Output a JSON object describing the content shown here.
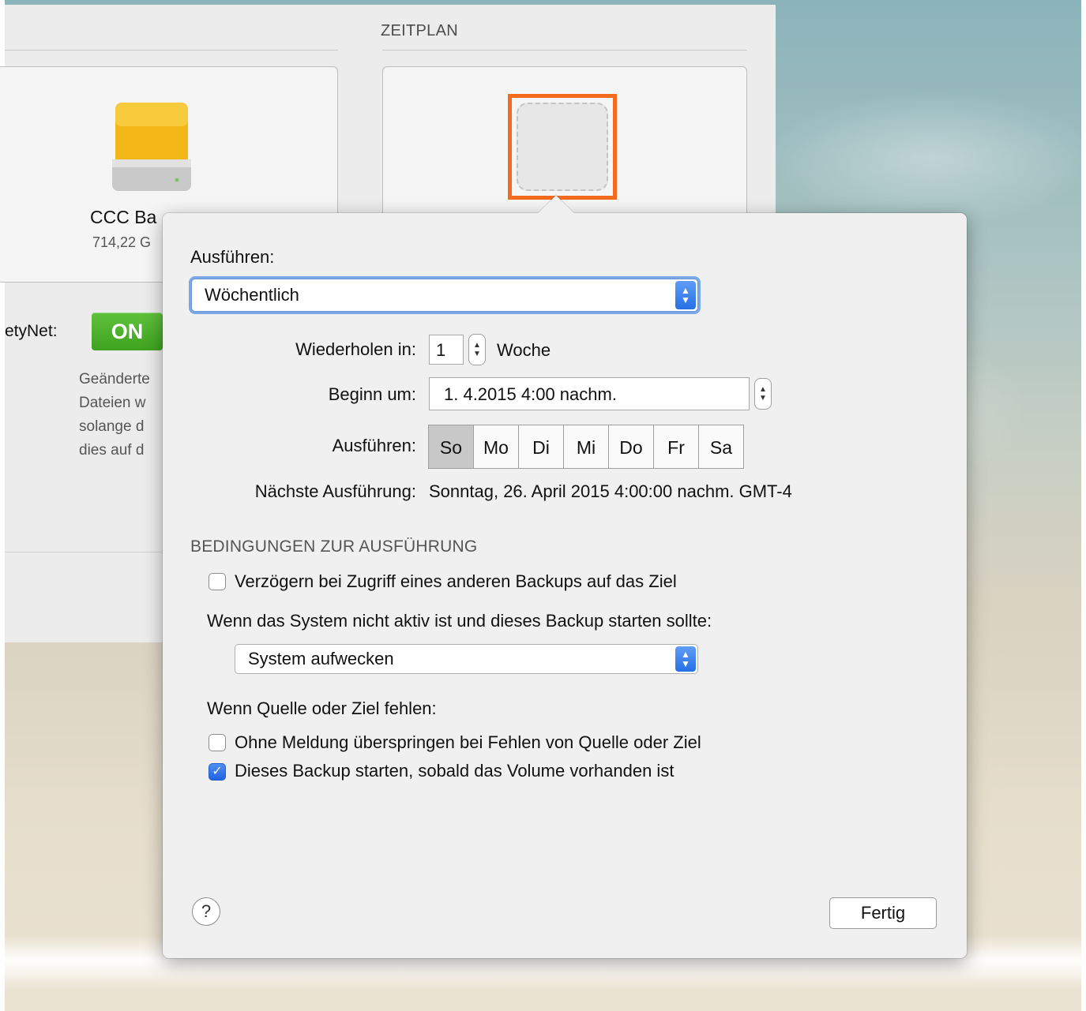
{
  "back_window": {
    "schedule_section_title": "ZEITPLAN",
    "source_drive_title": "CCC Ba",
    "source_drive_size": "714,22 G",
    "safetynet_label": "etyNet:",
    "safetynet_switch": "ON",
    "safetynet_desc": [
      "Geänderte",
      "Dateien w",
      "solange d",
      "dies auf d"
    ]
  },
  "popover": {
    "run_label": "Ausführen:",
    "frequency": "Wöchentlich",
    "repeat_label": "Wiederholen in:",
    "repeat_value": "1",
    "repeat_unit": "Woche",
    "start_label": "Beginn um:",
    "start_value": "1.  4.2015   4:00 nachm.",
    "days_label": "Ausführen:",
    "days": [
      "So",
      "Mo",
      "Di",
      "Mi",
      "Do",
      "Fr",
      "Sa"
    ],
    "selected_day": "So",
    "next_run_label": "Nächste Ausführung:",
    "next_run_value": "Sonntag, 26. April 2015 4:00:00 nachm. GMT-4",
    "conditions_title": "BEDINGUNGEN ZUR AUSFÜHRUNG",
    "delay_checkbox_label": "Verzögern bei Zugriff eines anderen Backups auf das Ziel",
    "delay_checked": false,
    "inactive_label": "Wenn das System nicht aktiv ist und dieses Backup starten sollte:",
    "inactive_option": "System aufwecken",
    "missing_label": "Wenn Quelle oder Ziel fehlen:",
    "skip_checkbox_label": "Ohne Meldung überspringen bei Fehlen von Quelle oder Ziel",
    "skip_checked": false,
    "start_when_present_label": "Dieses Backup starten, sobald das Volume vorhanden ist",
    "start_when_present_checked": true,
    "help_label": "?",
    "done_label": "Fertig"
  },
  "colors": {
    "accent_blue": "#2670e6",
    "highlight_orange": "#f26b1f",
    "switch_green": "#4cae2b"
  }
}
